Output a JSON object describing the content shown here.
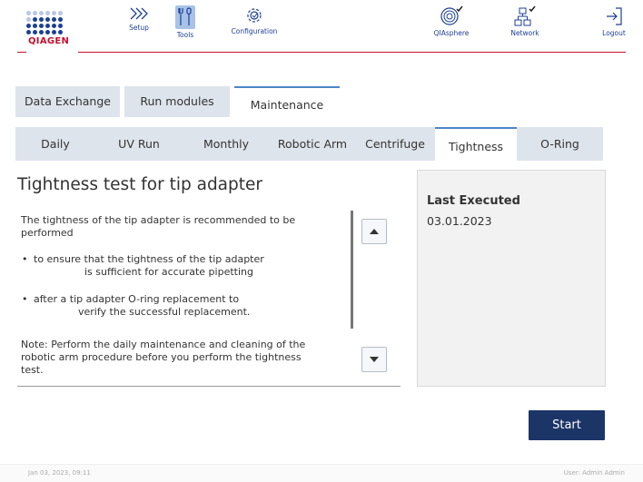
{
  "header": {
    "logo_text": "QIAGEN",
    "nav": {
      "setup": "Setup",
      "tools": "Tools",
      "configuration": "Configuration",
      "qiasphere": "QIAsphere",
      "network": "Network",
      "logout": "Logout"
    },
    "accent_color": "#1c3f94",
    "brand_red": "#c8102e"
  },
  "tabs": [
    "Data Exchange",
    "Run modules",
    "Maintenance"
  ],
  "active_tab": "Maintenance",
  "subtabs": [
    "Daily",
    "UV Run",
    "Monthly",
    "Robotic Arm",
    "Centrifuge",
    "Tightness",
    "O-Ring"
  ],
  "active_subtab": "Tightness",
  "content": {
    "title": "Tightness test for tip adapter",
    "intro_1": "The tightness of the tip adapter is recommended to be",
    "intro_2": "performed",
    "bullet1_1": "to ensure that the tightness of the tip adapter",
    "bullet1_2": "is sufficient for accurate pipetting",
    "bullet2_1": "after a tip adapter O-ring replacement to",
    "bullet2_2": "verify the successful replacement.",
    "note_1": "Note: Perform the daily maintenance and cleaning of the",
    "note_2": "robotic arm procedure before you perform the tightness",
    "note_3": "test."
  },
  "panel": {
    "heading": "Last Executed",
    "value": "03.01.2023"
  },
  "start_label": "Start",
  "footer": {
    "datetime": "Jan 03, 2023,  09:11",
    "user": "User: Admin Admin"
  }
}
